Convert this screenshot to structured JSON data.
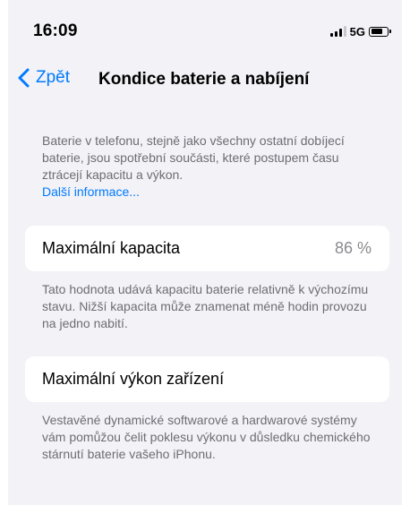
{
  "status_bar": {
    "time": "16:09",
    "network": "5G",
    "battery_level": 0.8
  },
  "nav": {
    "back_label": "Zpět",
    "title": "Kondice baterie a nabíjení"
  },
  "intro": {
    "text": "Baterie v telefonu, stejně jako všechny ostatní dobíjecí baterie, jsou spotřební součásti, které postupem času ztrácejí kapacitu a výkon.",
    "link": "Další informace..."
  },
  "max_capacity": {
    "label": "Maximální kapacita",
    "value": "86 %",
    "footer": "Tato hodnota udává kapacitu baterie relativně k výchozímu stavu. Nižší kapacita může znamenat méně hodin provozu na jedno nabití."
  },
  "max_performance": {
    "label": "Maximální výkon zařízení",
    "footer": "Vestavěné dynamické softwarové a hardwarové systémy vám pomůžou čelit poklesu výkonu v důsledku chemického stárnutí baterie vašeho iPhonu."
  },
  "colors": {
    "accent": "#007aff",
    "background": "#f2f2f7",
    "card": "#ffffff",
    "secondary_text": "#6d6d72"
  },
  "icons": {
    "back": "chevron-left-icon",
    "signal": "cellular-signal-icon",
    "battery": "battery-icon"
  }
}
